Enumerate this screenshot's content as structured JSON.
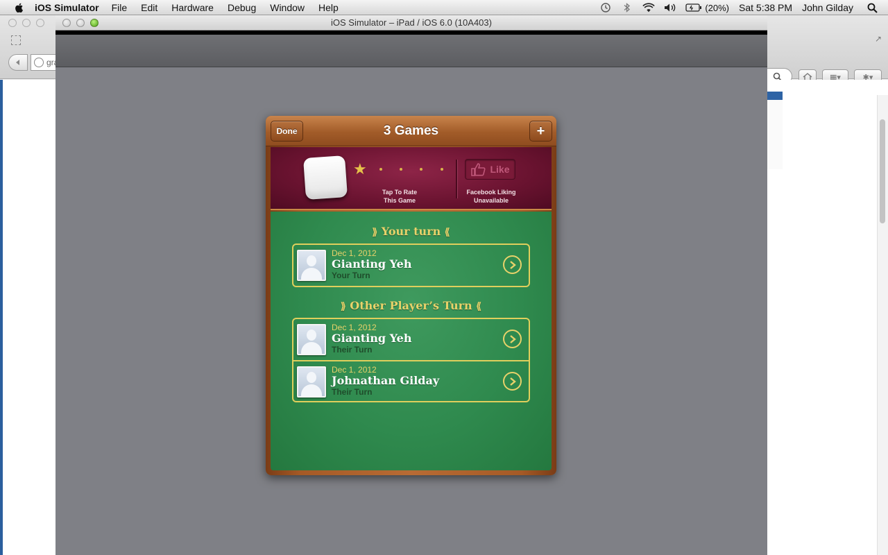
{
  "menubar": {
    "app_name": "iOS Simulator",
    "menus": [
      "File",
      "Edit",
      "Hardware",
      "Debug",
      "Window",
      "Help"
    ],
    "battery_pct": "(20%)",
    "clock": "Sat 5:38 PM",
    "user": "John Gilday"
  },
  "browser": {
    "url_fragment": "gra"
  },
  "simulator": {
    "title": "iOS Simulator – iPad / iOS 6.0 (10A403)"
  },
  "game_center": {
    "title": "3 Games",
    "done_label": "Done",
    "add_label": "+",
    "rate_label_line1": "Tap To Rate",
    "rate_label_line2": "This Game",
    "like_label": "Like",
    "fb_label_line1": "Facebook Liking",
    "fb_label_line2": "Unavailable",
    "rating_filled_stars": 1,
    "rating_max_stars": 5,
    "sections": [
      {
        "header": "Your turn",
        "games": [
          {
            "date": "Dec 1, 2012",
            "name": "Gianting Yeh",
            "status": "Your Turn"
          }
        ]
      },
      {
        "header": "Other Player’s Turn",
        "games": [
          {
            "date": "Dec 1, 2012",
            "name": "Gianting Yeh",
            "status": "Their Turn"
          },
          {
            "date": "Dec 1, 2012",
            "name": "Johnathan Gilday",
            "status": "Their Turn"
          }
        ]
      }
    ]
  },
  "colors": {
    "felt_green": "#2f8a4e",
    "accent_gold": "#e8d26a",
    "promo_maroon": "#6a1330",
    "wood": "#a55a26"
  },
  "icons": [
    "apple-icon",
    "time-machine-icon",
    "bluetooth-icon",
    "wifi-icon",
    "volume-icon",
    "battery-icon",
    "spotlight-icon",
    "thumbs-up-icon",
    "star-icon",
    "chevron-right-icon",
    "avatar-placeholder-icon"
  ]
}
